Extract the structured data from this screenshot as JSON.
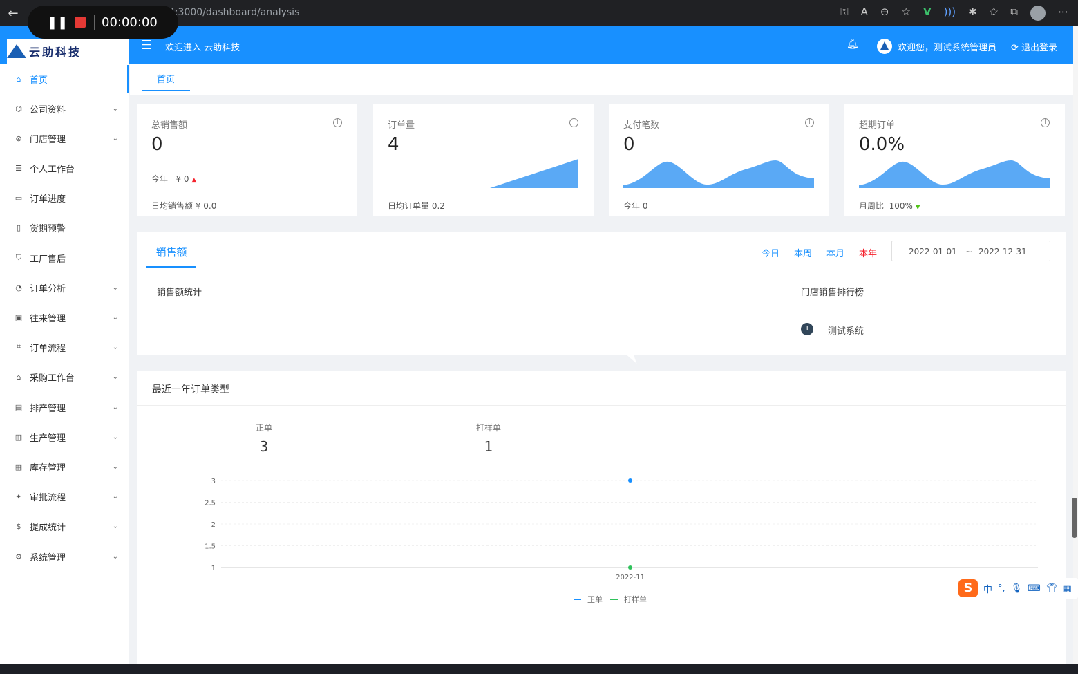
{
  "browser": {
    "url": "localhost:3000/dashboard/analysis",
    "recording_time": "00:00:00"
  },
  "header": {
    "welcome_system": "欢迎进入 云助科技",
    "welcome_user": "欢迎您，测试系统管理员",
    "logout": "退出登录",
    "logo_text": "云助科技"
  },
  "sidebar": {
    "items": [
      {
        "label": "首页",
        "icon": "home-icon",
        "expandable": false,
        "active": true
      },
      {
        "label": "公司资料",
        "icon": "bank-icon",
        "expandable": true
      },
      {
        "label": "门店管理",
        "icon": "shop-icon",
        "expandable": true
      },
      {
        "label": "个人工作台",
        "icon": "desk-icon",
        "expandable": false
      },
      {
        "label": "订单进度",
        "icon": "monitor-icon",
        "expandable": false
      },
      {
        "label": "货期预警",
        "icon": "file-icon",
        "expandable": false
      },
      {
        "label": "工厂售后",
        "icon": "shield-icon",
        "expandable": false
      },
      {
        "label": "订单分析",
        "icon": "pie-icon",
        "expandable": true
      },
      {
        "label": "往来管理",
        "icon": "ledger-icon",
        "expandable": true
      },
      {
        "label": "订单流程",
        "icon": "flow-icon",
        "expandable": true
      },
      {
        "label": "采购工作台",
        "icon": "house-icon",
        "expandable": true
      },
      {
        "label": "排产管理",
        "icon": "schedule-icon",
        "expandable": true
      },
      {
        "label": "生产管理",
        "icon": "factory-icon",
        "expandable": true
      },
      {
        "label": "库存管理",
        "icon": "stock-icon",
        "expandable": true
      },
      {
        "label": "审批流程",
        "icon": "bird-icon",
        "expandable": true
      },
      {
        "label": "提成统计",
        "icon": "dollar-icon",
        "expandable": true
      },
      {
        "label": "系统管理",
        "icon": "gear-icon",
        "expandable": true
      }
    ]
  },
  "tabs": {
    "home": "首页"
  },
  "cards": [
    {
      "title": "总销售额",
      "value": "0",
      "mid_label": "今年",
      "mid_value": "¥ 0",
      "foot": "日均销售额 ¥ 0.0"
    },
    {
      "title": "订单量",
      "value": "4",
      "foot": "日均订单量 0.2"
    },
    {
      "title": "支付笔数",
      "value": "0",
      "foot": "今年 0"
    },
    {
      "title": "超期订单",
      "value": "0.0%",
      "foot_label": "月周比",
      "foot_value": "100%"
    }
  ],
  "sales": {
    "tab": "销售额",
    "ranges": [
      "今日",
      "本周",
      "本月",
      "本年"
    ],
    "active_range": "本年",
    "date_start": "2022-01-01",
    "date_sep": "~",
    "date_end": "2022-12-31",
    "stat_title": "销售额统计",
    "rank_title": "门店销售排行榜",
    "rank": [
      {
        "no": "1",
        "name": "测试系统"
      }
    ]
  },
  "orders": {
    "title": "最近一年订单类型",
    "stats": [
      {
        "label": "正单",
        "value": "3"
      },
      {
        "label": "打样单",
        "value": "1"
      }
    ]
  },
  "chart_data": {
    "type": "line",
    "title": "",
    "x": [
      "2022-11"
    ],
    "series": [
      {
        "name": "正单",
        "values": [
          3
        ],
        "color": "#1890ff"
      },
      {
        "name": "打样单",
        "values": [
          1
        ],
        "color": "#2fc25b"
      }
    ],
    "y_ticks": [
      "1",
      "1.5",
      "2",
      "2.5",
      "3"
    ],
    "ylim": [
      1,
      3
    ],
    "legend": "bottom",
    "grid": true
  },
  "ime": {
    "chinese": "中",
    "punct": "°,"
  }
}
